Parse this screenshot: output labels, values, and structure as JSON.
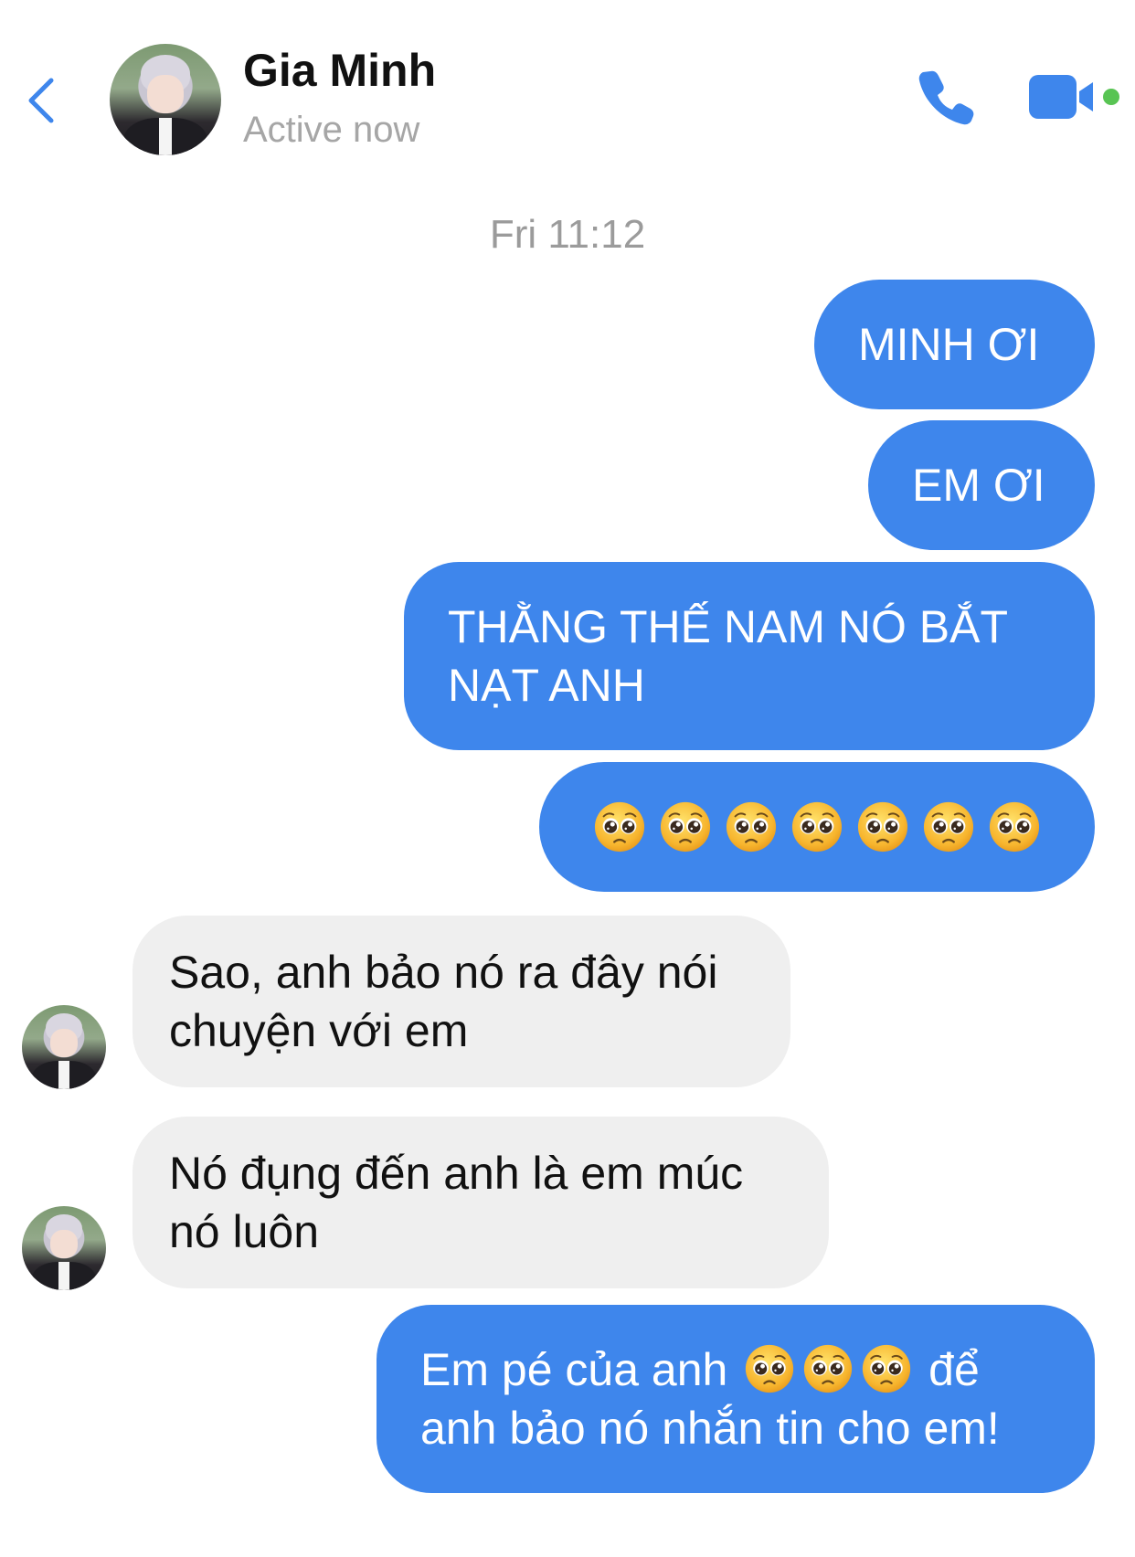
{
  "header": {
    "contact_name": "Gia Minh",
    "status": "Active now",
    "back_icon": "chevron-left-icon",
    "call_icon": "phone-icon",
    "video_icon": "video-camera-icon",
    "accent_color": "#3e86ec",
    "online_dot_color": "#58c453"
  },
  "conversation": {
    "timestamp": "Fri 11:12",
    "messages": [
      {
        "direction": "outgoing",
        "text": "MINH ƠI"
      },
      {
        "direction": "outgoing",
        "text": "EM ƠI"
      },
      {
        "direction": "outgoing",
        "line1": "THẰNG THẾ NAM NÓ BẮT",
        "line2": "NẠT ANH"
      },
      {
        "direction": "outgoing",
        "emoji": "pleading-face",
        "emoji_count": 7
      },
      {
        "direction": "incoming",
        "line1": "Sao, anh bảo nó ra đây nói",
        "line2": "chuyện với em"
      },
      {
        "direction": "incoming",
        "line1": "Nó đụng đến anh là em múc",
        "line2": "nó luôn"
      },
      {
        "direction": "outgoing",
        "line1_before": "Em pé của anh",
        "line1_after": "để",
        "line1_emoji_count": 3,
        "line2": "anh bảo nó nhắn tin cho em!"
      }
    ]
  },
  "colors": {
    "outgoing_bubble": "#3e86ec",
    "incoming_bubble": "#efefef",
    "timestamp": "#9b9b9b",
    "status": "#a6a6a6"
  }
}
